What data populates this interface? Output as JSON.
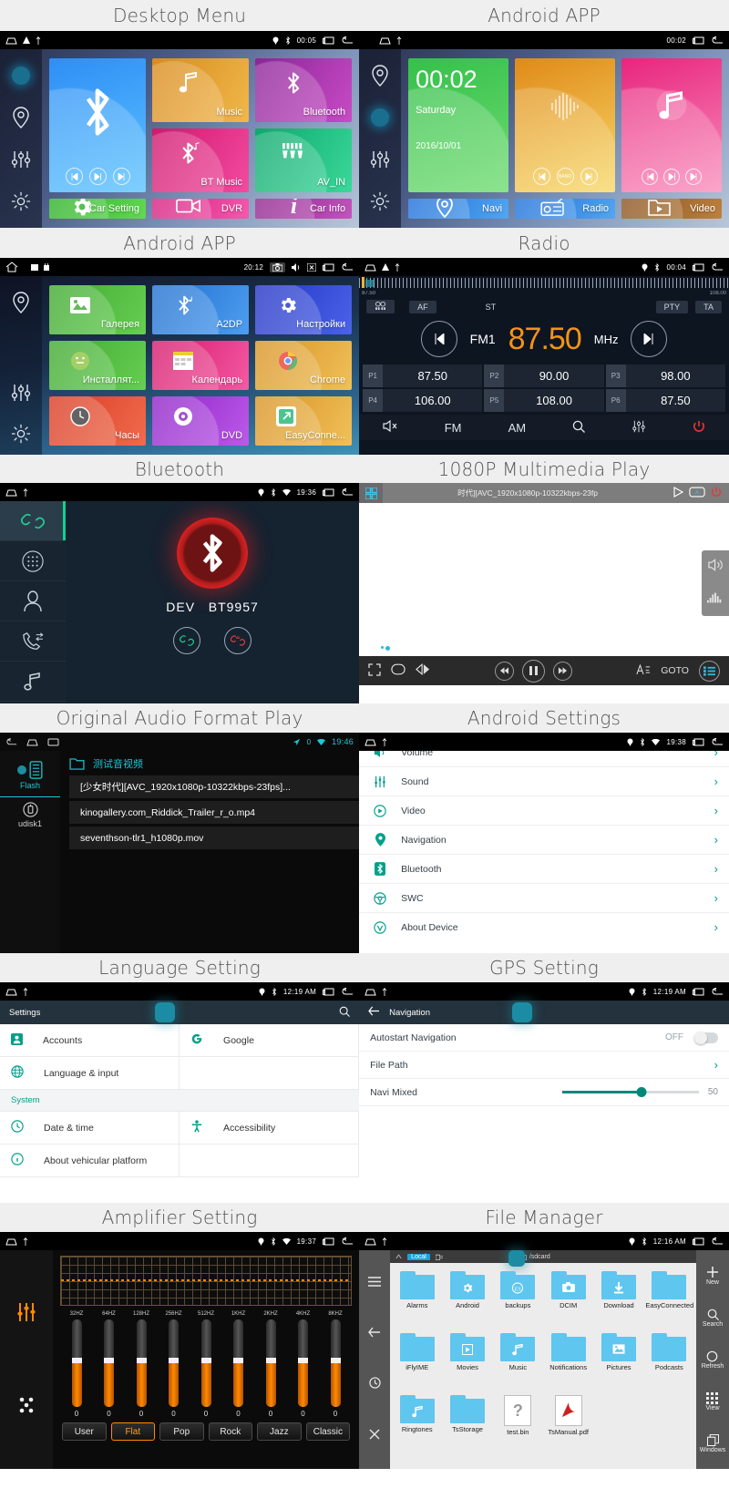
{
  "captions": {
    "desktop_menu": "Desktop Menu",
    "android_app_1": "Android APP",
    "android_app_2": "Android APP",
    "radio": "Radio",
    "bluetooth": "Bluetooth",
    "multimedia": "1080P Multimedia Play",
    "original_audio": "Original Audio Format Play",
    "android_settings": "Android Settings",
    "language_setting": "Language Setting",
    "gps_setting": "GPS Setting",
    "amplifier_setting": "Amplifier Setting",
    "file_manager": "File Manager"
  },
  "desktop_menu": {
    "statusbar": {
      "clock": "00:05"
    },
    "sidebar": [
      "nav-indicator-dot",
      "location-pin-icon",
      "equalizer-icon",
      "gear-icon"
    ],
    "big_tile": {
      "label": "",
      "icon": "bluetooth-icon",
      "controls": [
        "prev-icon",
        "play-pause-icon",
        "next-icon"
      ]
    },
    "tiles": [
      {
        "label": "Music",
        "icon": "music-note-icon",
        "color": "#e09a2a"
      },
      {
        "label": "Bluetooth",
        "icon": "bluetooth-icon",
        "color": "#9b2fa0"
      },
      {
        "label": "BT Music",
        "icon": "bt-music-icon",
        "color": "#e31e78"
      },
      {
        "label": "AV_IN",
        "icon": "av-in-icon",
        "color": "#17b87b"
      },
      {
        "label": "Car Setting",
        "icon": "gear-icon",
        "color": "#3cc136"
      },
      {
        "label": "DVR",
        "icon": "video-camera-icon",
        "color": "#e9328c"
      },
      {
        "label": "Car Info",
        "icon": "info-icon",
        "color": "#a03094"
      }
    ]
  },
  "android_app": {
    "statusbar": {
      "clock": "00:02"
    },
    "clock_tile": {
      "time": "00:02",
      "weekday": "Saturday",
      "date": "2016/10/01"
    },
    "radio_tile": {
      "label": "",
      "controls": [
        "prev-icon",
        "band-icon",
        "next-icon"
      ]
    },
    "music_tile": {
      "label": "",
      "controls": [
        "prev-icon",
        "play-pause-icon",
        "next-icon"
      ]
    },
    "tiles": [
      {
        "label": "Navi",
        "icon": "location-pin-icon",
        "color": "#2f7fe0"
      },
      {
        "label": "Radio",
        "icon": "radio-icon",
        "color": "#2f7fe0"
      },
      {
        "label": "Video",
        "icon": "video-folder-icon",
        "color": "#a4662c"
      }
    ]
  },
  "android_app_ru": {
    "statusbar": {
      "clock": "20:12"
    },
    "tiles": [
      {
        "label": "Галерея",
        "icon": "gallery-icon",
        "color": "#4cbb3c"
      },
      {
        "label": "A2DP",
        "icon": "bluetooth-icon",
        "color": "#2f8fe0"
      },
      {
        "label": "Настройки",
        "icon": "gear-icon",
        "color": "#2f44d8"
      },
      {
        "label": "Инсталлят...",
        "icon": "android-icon",
        "color": "#4cbb3c"
      },
      {
        "label": "Календарь",
        "icon": "calendar-icon",
        "color": "#ea2c79"
      },
      {
        "label": "Chrome",
        "icon": "chrome-icon",
        "color": "#e8a32c"
      },
      {
        "label": "Часы",
        "icon": "clock-icon",
        "color": "#e8462c"
      },
      {
        "label": "DVD",
        "icon": "disc-icon",
        "color": "#a52fd8"
      },
      {
        "label": "EasyConne...",
        "icon": "easyconnect-icon",
        "color": "#e8a32c"
      }
    ]
  },
  "radio": {
    "statusbar": {
      "clock": "00:04"
    },
    "scale": {
      "min": "87.50",
      "max": "108.00"
    },
    "rds_buttons": [
      "AF",
      "ST",
      "PTY",
      "TA"
    ],
    "band": "FM1",
    "frequency": "87.50",
    "unit": "MHz",
    "presets": [
      {
        "id": "P1",
        "freq": "87.50"
      },
      {
        "id": "P2",
        "freq": "90.00"
      },
      {
        "id": "P3",
        "freq": "98.00"
      },
      {
        "id": "P4",
        "freq": "106.00"
      },
      {
        "id": "P5",
        "freq": "108.00"
      },
      {
        "id": "P6",
        "freq": "87.50"
      }
    ],
    "bottom_bar": [
      "mute-icon",
      "FM",
      "AM",
      "search-icon",
      "equalizer-icon",
      "power-icon"
    ]
  },
  "bluetooth": {
    "statusbar": {
      "clock": "19:36"
    },
    "sidebar": [
      "link-icon",
      "dialpad-icon",
      "contacts-icon",
      "call-history-icon",
      "bt-music-icon"
    ],
    "dev_label": "DEV",
    "dev_name": "BT9957",
    "actions": [
      "connect-icon",
      "disconnect-icon"
    ]
  },
  "multimedia": {
    "title": "时代][AVC_1920x1080p-10322kbps-23fp",
    "top_buttons": [
      "play-icon",
      "aspect-ratio-icon",
      "power-icon"
    ],
    "side_buttons": [
      "volume-icon",
      "equalizer-bars-icon"
    ],
    "bottom_left": [
      "fullscreen-icon",
      "repeat-icon",
      "mirror-icon"
    ],
    "bottom_center": [
      "prev-track-icon",
      "pause-icon",
      "next-track-icon"
    ],
    "bottom_right_label": "GOTO",
    "bottom_right": [
      "subtitle-icon",
      "playlist-icon"
    ]
  },
  "original_audio": {
    "statusbar": {
      "clock": "19:46",
      "badge": "0"
    },
    "sources": [
      {
        "label": "Flash",
        "icon": "flash-storage-icon",
        "selected": true
      },
      {
        "label": "udisk1",
        "icon": "usb-disk-icon",
        "selected": false
      }
    ],
    "folder": "测试音视频",
    "files": [
      "[少女时代][AVC_1920x1080p-10322kbps-23fps]...",
      "kinogallery.com_Riddick_Trailer_r_o.mp4",
      "seventhson-tlr1_h1080p.mov"
    ]
  },
  "android_settings": {
    "statusbar": {
      "clock": "19:38"
    },
    "rows": [
      {
        "label": "Volume",
        "icon": "volume-icon"
      },
      {
        "label": "Sound",
        "icon": "sound-icon"
      },
      {
        "label": "Video",
        "icon": "video-icon"
      },
      {
        "label": "Navigation",
        "icon": "location-pin-icon"
      },
      {
        "label": "Bluetooth",
        "icon": "bluetooth-icon"
      },
      {
        "label": "SWC",
        "icon": "steering-wheel-icon"
      },
      {
        "label": "About Device",
        "icon": "info-icon"
      }
    ]
  },
  "language_setting": {
    "statusbar": {
      "clock": "12:19 AM"
    },
    "appbar_title": "Settings",
    "items_left": [
      "Accounts",
      "Language & input"
    ],
    "items_right": [
      "Google",
      ""
    ],
    "section": "System",
    "system_left": [
      "Date & time",
      "About vehicular platform"
    ],
    "system_right": [
      "Accessibility",
      ""
    ]
  },
  "gps_setting": {
    "statusbar": {
      "clock": "12:19 AM"
    },
    "appbar_title": "Navigation",
    "rows": [
      {
        "label": "Autostart Navigation",
        "value": "OFF",
        "type": "toggle"
      },
      {
        "label": "File Path",
        "value": "",
        "type": "chevron"
      },
      {
        "label": "Navi Mixed",
        "value": "50",
        "type": "slider"
      }
    ]
  },
  "amplifier": {
    "statusbar": {
      "clock": "19:37"
    },
    "bands": [
      "32HZ",
      "64HZ",
      "128HZ",
      "256HZ",
      "512HZ",
      "1KHZ",
      "2KHZ",
      "4KHZ",
      "8KHZ"
    ],
    "values": [
      "0",
      "0",
      "0",
      "0",
      "0",
      "0",
      "0",
      "0",
      "0"
    ],
    "presets": [
      "User",
      "Flat",
      "Pop",
      "Rock",
      "Jazz",
      "Classic"
    ],
    "selected_preset": "Flat",
    "accent": "#ff8a00"
  },
  "file_manager": {
    "statusbar": {
      "clock": "12:16 AM"
    },
    "tab": "Local",
    "path": "/sdcard",
    "items": [
      {
        "name": "Alarms",
        "type": "folder",
        "icon": ""
      },
      {
        "name": "Android",
        "type": "folder",
        "icon": "gear-icon"
      },
      {
        "name": "backups",
        "type": "folder",
        "icon": "es-icon"
      },
      {
        "name": "DCIM",
        "type": "folder",
        "icon": "camera-icon"
      },
      {
        "name": "Download",
        "type": "folder",
        "icon": "download-icon"
      },
      {
        "name": "EasyConnected",
        "type": "folder",
        "icon": ""
      },
      {
        "name": "iFlyIME",
        "type": "folder",
        "icon": ""
      },
      {
        "name": "Movies",
        "type": "folder",
        "icon": "play-icon"
      },
      {
        "name": "Music",
        "type": "folder",
        "icon": "music-note-icon"
      },
      {
        "name": "Notifications",
        "type": "folder",
        "icon": ""
      },
      {
        "name": "Pictures",
        "type": "folder",
        "icon": "image-icon"
      },
      {
        "name": "Podcasts",
        "type": "folder",
        "icon": ""
      },
      {
        "name": "Ringtones",
        "type": "folder",
        "icon": "music-note-icon"
      },
      {
        "name": "TsStorage",
        "type": "folder",
        "icon": ""
      },
      {
        "name": "test.bin",
        "type": "file",
        "icon": "unknown-file-icon"
      },
      {
        "name": "TsManual.pdf",
        "type": "file",
        "icon": "pdf-icon"
      }
    ],
    "right_tools": [
      {
        "label": "New",
        "icon": "plus-icon"
      },
      {
        "label": "Search",
        "icon": "search-icon"
      },
      {
        "label": "Refresh",
        "icon": "refresh-icon"
      },
      {
        "label": "View",
        "icon": "grid-icon"
      },
      {
        "label": "Windows",
        "icon": "windows-icon"
      }
    ],
    "left_tools": [
      "menu-icon",
      "back-icon",
      "history-icon",
      "close-icon"
    ]
  }
}
